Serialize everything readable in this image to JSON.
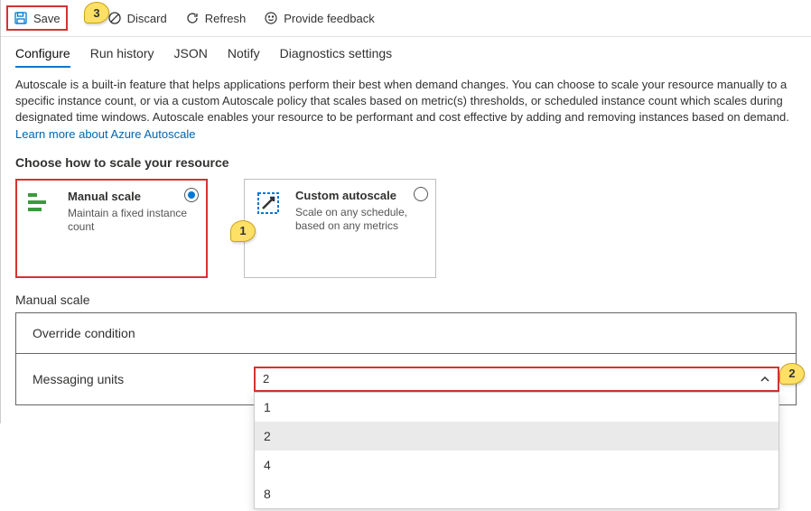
{
  "toolbar": {
    "save": "Save",
    "discard": "Discard",
    "refresh": "Refresh",
    "feedback": "Provide feedback"
  },
  "tabs": [
    {
      "label": "Configure",
      "active": true
    },
    {
      "label": "Run history",
      "active": false
    },
    {
      "label": "JSON",
      "active": false
    },
    {
      "label": "Notify",
      "active": false
    },
    {
      "label": "Diagnostics settings",
      "active": false
    }
  ],
  "description": "Autoscale is a built-in feature that helps applications perform their best when demand changes. You can choose to scale your resource manually to a specific instance count, or via a custom Autoscale policy that scales based on metric(s) thresholds, or scheduled instance count which scales during designated time windows. Autoscale enables your resource to be performant and cost effective by adding and removing instances based on demand. ",
  "learn_link": "Learn more about Azure Autoscale",
  "choose_header": "Choose how to scale your resource",
  "cards": {
    "manual": {
      "title": "Manual scale",
      "sub": "Maintain a fixed instance count"
    },
    "custom": {
      "title": "Custom autoscale",
      "sub": "Scale on any schedule, based on any metrics"
    }
  },
  "manual_heading": "Manual scale",
  "override_label": "Override condition",
  "units_label": "Messaging units",
  "units_value": "2",
  "units_options": [
    "1",
    "2",
    "4",
    "8"
  ],
  "callouts": {
    "c1": "1",
    "c2": "2",
    "c3": "3"
  }
}
